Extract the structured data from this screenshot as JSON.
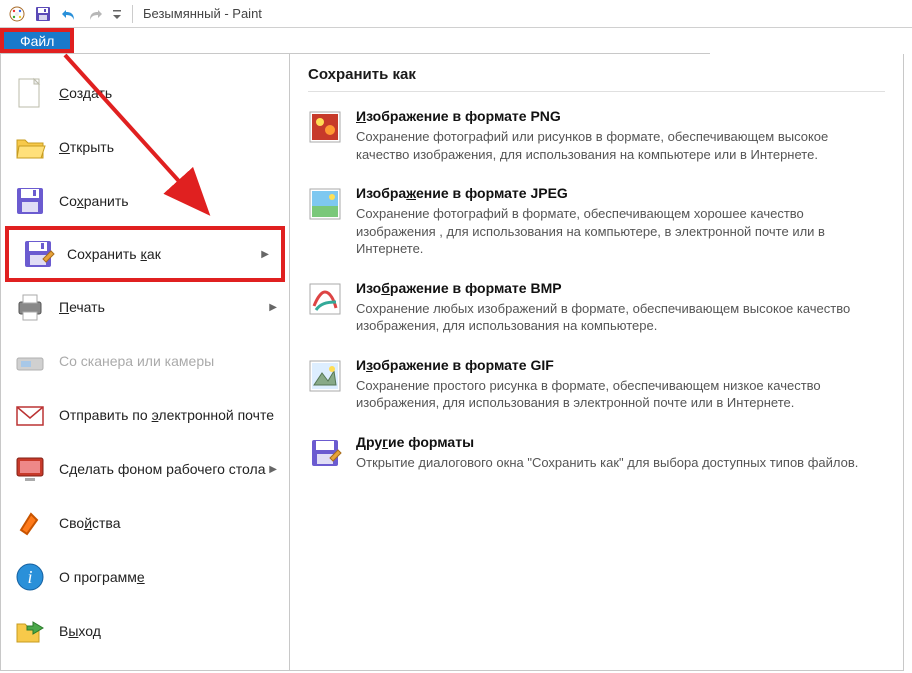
{
  "titlebar": {
    "title": "Безымянный - Paint"
  },
  "tabs": {
    "file": "Файл"
  },
  "filemenu": {
    "create": "Создать",
    "open": "Открыть",
    "save": "Сохранить",
    "saveas": "Сохранить как",
    "print": "Печать",
    "scanner": "Со сканера или камеры",
    "email": "Отправить по электронной почте",
    "wallpaper": "Сделать фоном рабочего стола",
    "properties": "Свойства",
    "about": "О программе",
    "exit": "Выход"
  },
  "submenu": {
    "heading": "Сохранить как",
    "items": [
      {
        "title": "Изображение в формате PNG",
        "desc": "Сохранение фотографий или рисунков в формате, обеспечивающем высокое качество изображения, для использования на компьютере или в Интернете."
      },
      {
        "title": "Изображение в формате JPEG",
        "desc": "Сохранение фотографий в формате, обеспечивающем хорошее качество изображения , для использования на компьютере, в электронной почте или в Интернете."
      },
      {
        "title": "Изображение в формате BMP",
        "desc": "Сохранение любых изображений в формате, обеспечивающем высокое качество изображения, для использования на компьютере."
      },
      {
        "title": "Изображение в формате GIF",
        "desc": "Сохранение простого рисунка в формате, обеспечивающем низкое качество изображения, для использования в электронной почте или в Интернете."
      },
      {
        "title": "Другие форматы",
        "desc": "Открытие диалогового окна \"Сохранить как\" для выбора доступных типов файлов."
      }
    ]
  }
}
